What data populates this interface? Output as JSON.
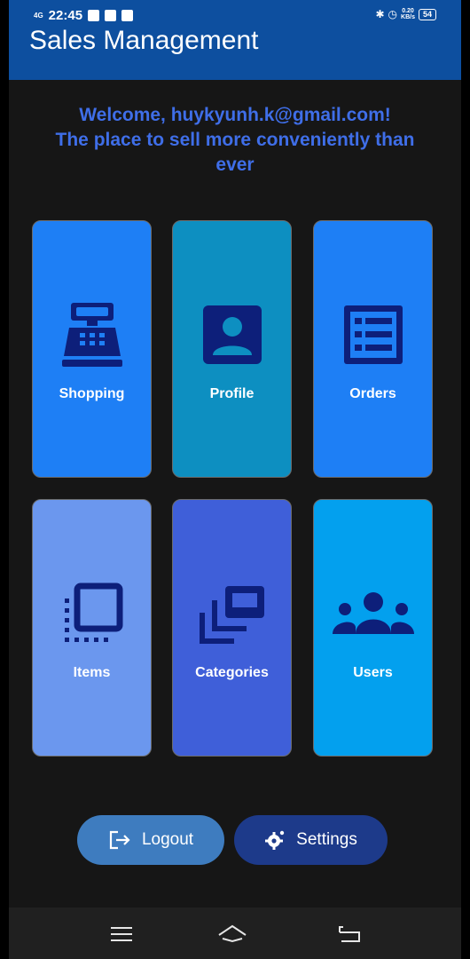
{
  "status_bar": {
    "network": "4G",
    "time": "22:45",
    "speed_value": "0.20",
    "speed_unit": "KB/s",
    "battery": "54"
  },
  "app_bar": {
    "title": "Sales Management"
  },
  "welcome": {
    "line1": "Welcome, huykyunh.k@gmail.com!",
    "line2": "The place to sell more conveniently than ever"
  },
  "tiles": [
    {
      "label": "Shopping",
      "icon": "cash-register-icon",
      "color": "#1e7ff5"
    },
    {
      "label": "Profile",
      "icon": "account-box-icon",
      "color": "#0d8fc1"
    },
    {
      "label": "Orders",
      "icon": "list-alt-icon",
      "color": "#1e7ff5"
    },
    {
      "label": "Items",
      "icon": "select-all-icon",
      "color": "#6b97ee"
    },
    {
      "label": "Categories",
      "icon": "library-icon",
      "color": "#3f5fd9"
    },
    {
      "label": "Users",
      "icon": "groups-icon",
      "color": "#03a0ee"
    }
  ],
  "buttons": {
    "logout_label": "Logout",
    "settings_label": "Settings"
  },
  "colors": {
    "app_bar": "#0d4f9f",
    "background": "#161616",
    "welcome_text": "#3f6ee8",
    "icon": "#0d1f7a",
    "logout_button": "#3e7cbf",
    "settings_button": "#1d3a8a"
  }
}
